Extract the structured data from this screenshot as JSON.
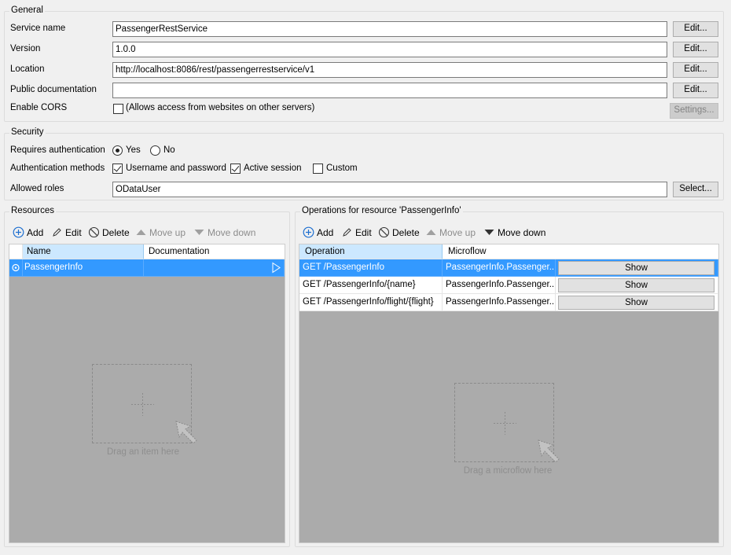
{
  "general": {
    "title": "General",
    "service_name_label": "Service name",
    "service_name_value": "PassengerRestService",
    "version_label": "Version",
    "version_value": "1.0.0",
    "location_label": "Location",
    "location_value": "http://localhost:8086/rest/passengerrestservice/v1",
    "public_doc_label": "Public documentation",
    "public_doc_value": "",
    "enable_cors_label": "Enable CORS",
    "enable_cors_checked": false,
    "enable_cors_text": "(Allows access from websites on other servers)",
    "edit_label": "Edit...",
    "settings_label": "Settings..."
  },
  "security": {
    "title": "Security",
    "requires_auth_label": "Requires authentication",
    "yes_label": "Yes",
    "no_label": "No",
    "requires_auth_value": "Yes",
    "auth_methods_label": "Authentication methods",
    "methods": [
      {
        "label": "Username and password",
        "checked": true
      },
      {
        "label": "Active session",
        "checked": true
      },
      {
        "label": "Custom",
        "checked": false
      }
    ],
    "allowed_roles_label": "Allowed roles",
    "allowed_roles_value": "ODataUser",
    "select_label": "Select..."
  },
  "resources": {
    "title": "Resources",
    "toolbar": {
      "add": "Add",
      "edit": "Edit",
      "delete": "Delete",
      "move_up": "Move up",
      "move_down": "Move down"
    },
    "columns": [
      "Name",
      "Documentation"
    ],
    "rows": [
      {
        "name": "PassengerInfo",
        "documentation": "",
        "selected": true
      }
    ],
    "drop_hint": "Drag an item here"
  },
  "operations": {
    "title": "Operations for resource 'PassengerInfo'",
    "toolbar": {
      "add": "Add",
      "edit": "Edit",
      "delete": "Delete",
      "move_up": "Move up",
      "move_down": "Move down"
    },
    "columns": [
      "Operation",
      "Microflow"
    ],
    "show_label": "Show",
    "rows": [
      {
        "operation": "GET /PassengerInfo",
        "microflow": "PassengerInfo.Passenger...",
        "selected": true
      },
      {
        "operation": "GET /PassengerInfo/{name}",
        "microflow": "PassengerInfo.Passenger...",
        "selected": false
      },
      {
        "operation": "GET /PassengerInfo/flight/{flight}",
        "microflow": "PassengerInfo.Passenger...",
        "selected": false
      }
    ],
    "drop_hint": "Drag a microflow here"
  },
  "colors": {
    "selection": "#3399ff",
    "header_sorted": "#cce8ff",
    "grid_background": "#ababab",
    "add_icon": "#1e6fd0"
  }
}
